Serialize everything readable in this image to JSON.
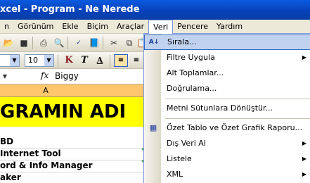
{
  "window": {
    "title": "xcel - Program - Ne Nerede"
  },
  "menubar": {
    "items": [
      {
        "label": "n"
      },
      {
        "label": "Görünüm"
      },
      {
        "label": "Ekle"
      },
      {
        "label": "Biçim"
      },
      {
        "label": "Araçlar"
      },
      {
        "label": "Veri"
      },
      {
        "label": "Pencere"
      },
      {
        "label": "Yardım"
      }
    ]
  },
  "toolbar_format": {
    "font_size": "10",
    "bold_label": "K",
    "italic_label": "T",
    "underline_label": "A"
  },
  "formula_bar": {
    "fx_label": "fx",
    "value": "Biggy"
  },
  "grid": {
    "column_a_header": "A",
    "title_cell": "GRAMIN ADI",
    "rows": [
      "BD",
      "Internet Tool",
      "ord & Info Manager",
      "aker"
    ]
  },
  "veri_menu": {
    "items": [
      {
        "label": "Sırala...",
        "has_submenu": false,
        "icon": "sort-icon"
      },
      {
        "label": "Filtre Uygula",
        "has_submenu": true
      },
      {
        "label": "Alt Toplamlar...",
        "has_submenu": false
      },
      {
        "label": "Doğrulama...",
        "has_submenu": false
      },
      {
        "label": "Metni Sütunlara Dönüştür...",
        "has_submenu": false
      },
      {
        "label": "Özet Tablo ve Özet Grafik Raporu...",
        "has_submenu": false,
        "icon": "pivot-table-icon"
      },
      {
        "label": "Dış Veri Al",
        "has_submenu": true
      },
      {
        "label": "Listele",
        "has_submenu": true
      },
      {
        "label": "XML",
        "has_submenu": true
      }
    ]
  },
  "colors": {
    "title_bar": "#0842b9",
    "highlight": "#c1d2ee",
    "title_cell_fill": "#ffff00",
    "column_header_selected": "#ffc66e"
  }
}
